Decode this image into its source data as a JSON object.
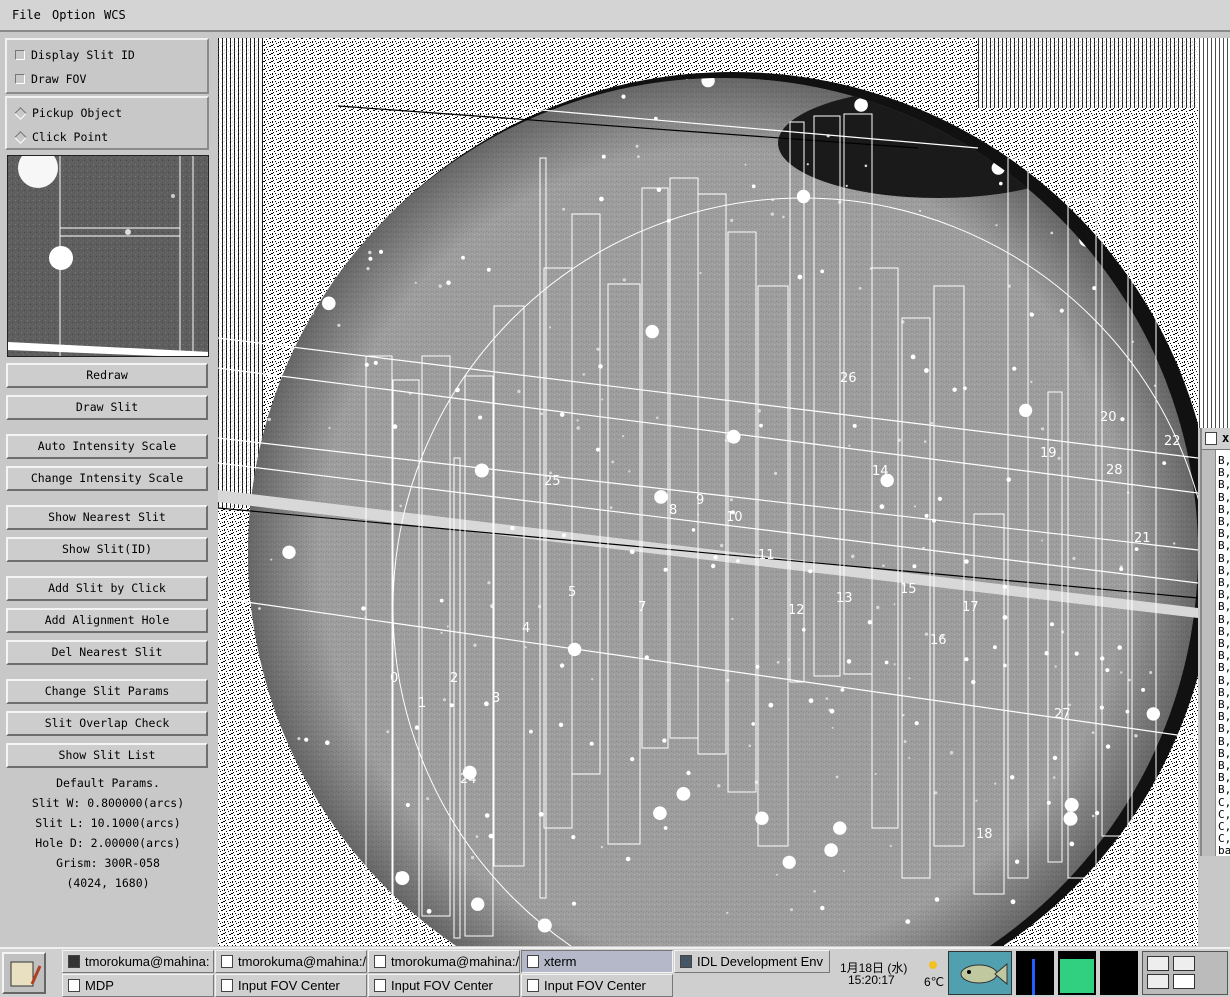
{
  "menubar": {
    "items": [
      "File",
      "Option",
      "WCS"
    ]
  },
  "options": {
    "display_slit_id": "Display Slit ID",
    "draw_fov": "Draw FOV",
    "pickup_object": "Pickup Object",
    "click_point": "Click Point"
  },
  "buttons": {
    "redraw": "Redraw",
    "draw_slit": "Draw Slit",
    "auto_intensity": "Auto Intensity Scale",
    "change_intensity": "Change Intensity Scale",
    "show_nearest_slit": "Show Nearest Slit",
    "show_slit_id": "Show Slit(ID)",
    "add_slit_by_click": "Add Slit by Click",
    "add_alignment_hole": "Add Alignment Hole",
    "del_nearest_slit": "Del Nearest Slit",
    "change_slit_params": "Change Slit Params",
    "slit_overlap_check": "Slit Overlap Check",
    "show_slit_list": "Show Slit List"
  },
  "params": {
    "heading": "Default Params.",
    "slit_w": "Slit W: 0.800000(arcs)",
    "slit_l": "Slit L: 10.1000(arcs)",
    "hole_d": "Hole D: 2.00000(arcs)",
    "grism": "Grism: 300R-058",
    "coords": "(4024, 1680)"
  },
  "slit_labels": [
    "0",
    "1",
    "2",
    "3",
    "4",
    "5",
    "7",
    "8",
    "9",
    "10",
    "11",
    "12",
    "13",
    "14",
    "15",
    "16",
    "17",
    "18",
    "19",
    "20",
    "21",
    "22",
    "24",
    "25",
    "26",
    "27",
    "28"
  ],
  "xterm": {
    "title": "x",
    "lines": [
      "B,",
      "B,",
      "B,",
      "B,",
      "B,",
      "B,",
      "B,",
      "B,",
      "B,",
      "B,",
      "B,",
      "B,",
      "B,",
      "B,",
      "B,",
      "B,",
      "B,",
      "B,",
      "B,",
      "B,",
      "B,",
      "B,",
      "B,",
      "B,",
      "B,",
      "B,",
      "B,",
      "B,",
      "C,",
      "C,",
      "C,",
      "C,",
      "ba"
    ]
  },
  "taskbar": {
    "tasks_top": [
      "tmorokuma@mahina:",
      "tmorokuma@mahina:/",
      "tmorokuma@mahina:/",
      "xterm",
      "IDL Development Env"
    ],
    "tasks_bottom": [
      "MDP",
      "Input FOV Center",
      "Input FOV Center",
      "Input FOV Center"
    ],
    "date": "1月18日 (水)",
    "time": "15:20:17",
    "temp": "6℃"
  }
}
